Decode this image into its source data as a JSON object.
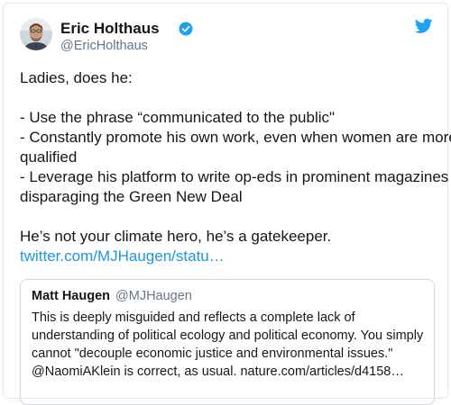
{
  "author": {
    "display_name": "Eric Holthaus",
    "handle": "@EricHolthaus",
    "verified_icon": "verified-badge-icon",
    "platform_icon": "twitter-bird-icon"
  },
  "tweet": {
    "lines": [
      "Ladies, does he:",
      "",
      "- Use the phrase “communicated to the public\"",
      "- Constantly promote his own work, even when women are more",
      "qualified",
      "- Leverage his platform to write op-eds in prominent magazines",
      "disparaging the Green New Deal",
      "",
      "He’s not your climate hero, he’s a gatekeeper."
    ],
    "link": "twitter.com/MJHaugen/statu…"
  },
  "quoted_tweet": {
    "display_name": "Matt Haugen",
    "handle": "@MJHaugen",
    "lines": [
      "This is deeply misguided and reflects a complete lack of",
      "understanding of political ecology and political economy. You simply",
      "cannot \"decouple economic justice and environmental issues.\"",
      "@NaomiAKlein is correct, as usual. nature.com/articles/d4158…"
    ]
  },
  "colors": {
    "accent": "#1da1f2",
    "link": "#1b95e0",
    "secondary_text": "#657786",
    "border": "#e1e8ed"
  }
}
